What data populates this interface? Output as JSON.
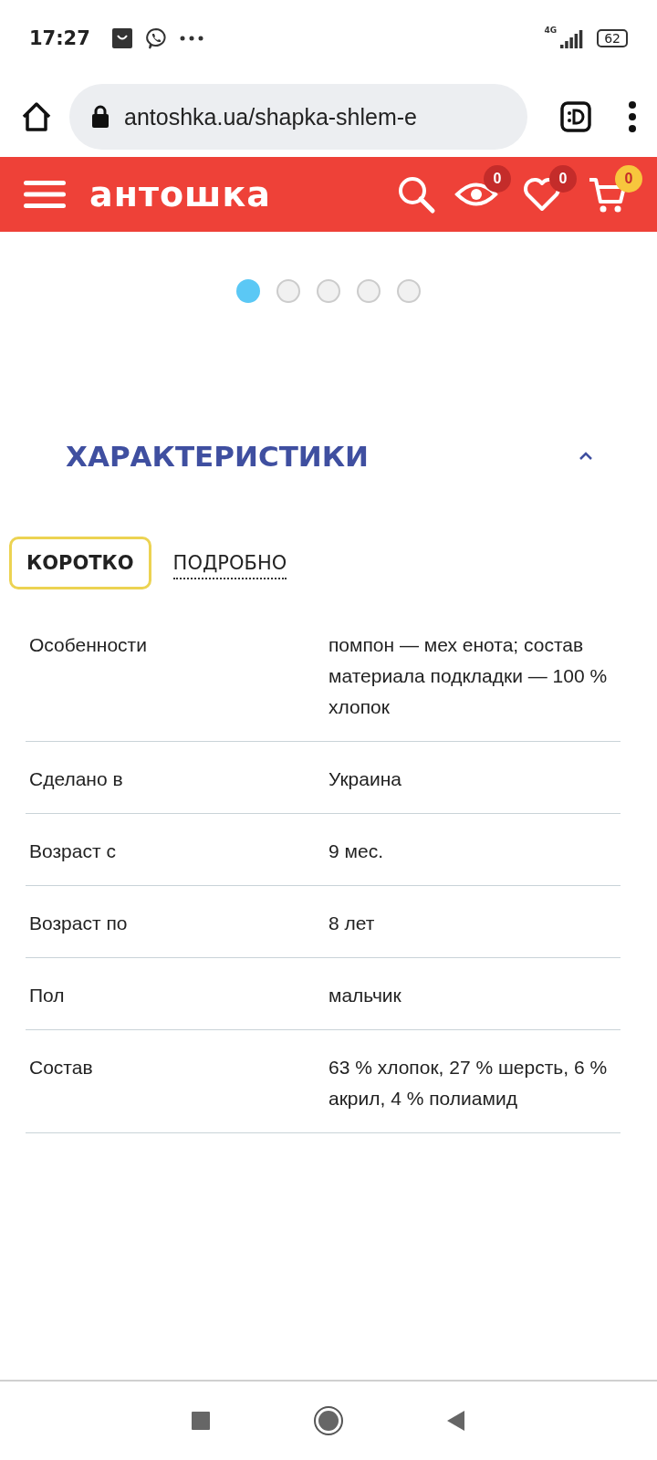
{
  "status_bar": {
    "time": "17:27",
    "network": "4G",
    "battery": "62"
  },
  "browser": {
    "url": "antoshka.ua/shapka-shlem-e"
  },
  "header": {
    "logo": "антошка",
    "badges": [
      {
        "kind": "eye",
        "count": "0"
      },
      {
        "kind": "heart",
        "count": "0"
      },
      {
        "kind": "cart",
        "count": "0"
      }
    ]
  },
  "carousel_dots": [
    {
      "selected": true
    },
    {
      "selected": false
    },
    {
      "selected": false
    },
    {
      "selected": false
    },
    {
      "selected": false
    }
  ],
  "section": {
    "title": "ХАРАКТЕРИСТИКИ",
    "expanded": true
  },
  "tabs": [
    {
      "label": "КОРОТКО",
      "selected": true
    },
    {
      "label": "ПОДРОБНО",
      "selected": false
    }
  ],
  "specs": [
    {
      "name": "Особенности",
      "value": "помпон — мех енота; состав материала подкладки — 100 % хлопок"
    },
    {
      "name": "Сделано в",
      "value": "Украина"
    },
    {
      "name": "Возраст с",
      "value": "9 мес."
    },
    {
      "name": "Возраст по",
      "value": "8 лет"
    },
    {
      "name": "Пол",
      "value": "мальчик"
    },
    {
      "name": "Состав",
      "value": "63 % хлопок, 27 % шерсть, 6 % акрил, 4 % полиамид"
    }
  ]
}
